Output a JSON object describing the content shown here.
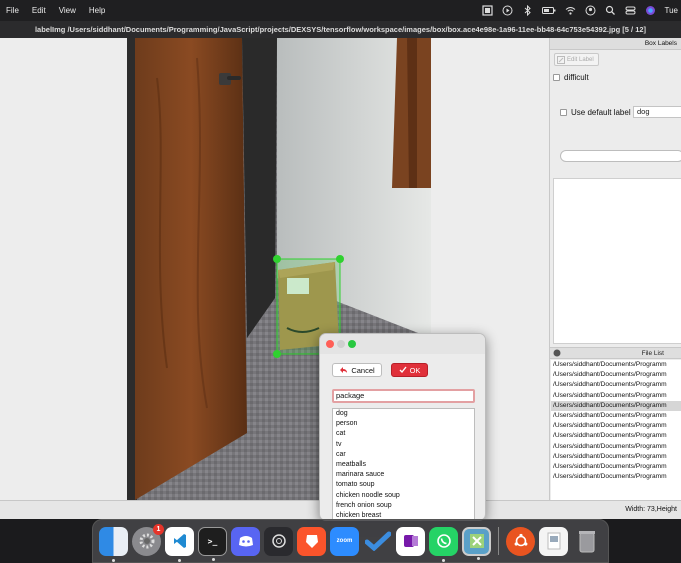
{
  "menubar": {
    "items": [
      "File",
      "Edit",
      "View",
      "Help"
    ],
    "clock": "Tue"
  },
  "window": {
    "title": "labelImg /Users/siddhant/Documents/Programming/JavaScript/projects/DEXSYS/tensorflow/workspace/images/box/box.ace4e98e-1a96-11ee-bb48-64c753e54392.jpg [5 / 12]"
  },
  "box_labels": {
    "header": "Box Labels",
    "edit_label": "Edit Label",
    "difficult": "difficult",
    "use_default": "Use default label",
    "default_value": "dog"
  },
  "file_list": {
    "header": "File List",
    "items": [
      "/Users/siddhant/Documents/Programm",
      "/Users/siddhant/Documents/Programm",
      "/Users/siddhant/Documents/Programm",
      "/Users/siddhant/Documents/Programm",
      "/Users/siddhant/Documents/Programm",
      "/Users/siddhant/Documents/Programm",
      "/Users/siddhant/Documents/Programm",
      "/Users/siddhant/Documents/Programm",
      "/Users/siddhant/Documents/Programm",
      "/Users/siddhant/Documents/Programm",
      "/Users/siddhant/Documents/Programm",
      "/Users/siddhant/Documents/Programm"
    ],
    "selected_index": 4
  },
  "status": {
    "text": "Width: 73,Height"
  },
  "dialog": {
    "cancel": "Cancel",
    "ok": "OK",
    "input_value": "package",
    "labels": [
      "dog",
      "person",
      "cat",
      "tv",
      "car",
      "meatballs",
      "marinara sauce",
      "tomato soup",
      "chicken noodle soup",
      "french onion soup",
      "chicken breast"
    ]
  },
  "dock": {
    "settings_badge": "1",
    "zoom_label": "zoom",
    "apps": [
      "finder-icon",
      "system-settings-icon",
      "vscode-icon",
      "terminal-icon",
      "discord-icon",
      "chatgpt-icon",
      "brave-icon",
      "zoom-icon",
      "microsoft-todo-icon",
      "onenote-icon",
      "whatsapp-icon",
      "labelimg-icon",
      "ubuntu-icon",
      "preview-icon",
      "trash-icon"
    ]
  },
  "colors": {
    "ok_button": "#e0303a",
    "bbox": "#2fd12f"
  }
}
